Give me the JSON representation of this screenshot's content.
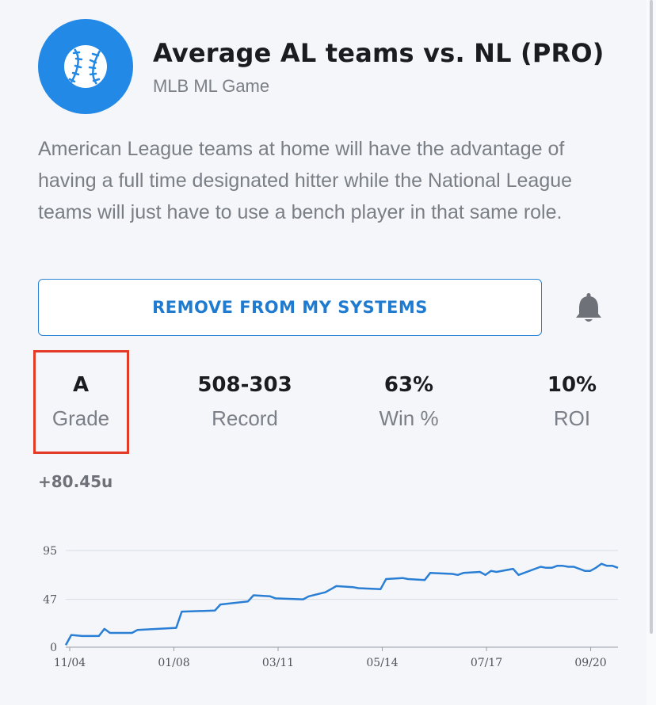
{
  "header": {
    "title": "Average AL teams vs. NL (PRO)",
    "subtitle": "MLB ML Game",
    "logo_icon": "baseball-icon",
    "logo_color": "#2289e6"
  },
  "description": "American League teams at home will have the advantage of having a full time designated hitter while the National League teams will just have to use a bench player in that same role.",
  "actions": {
    "remove_label": "REMOVE FROM MY SYSTEMS",
    "alert_icon": "bell-icon"
  },
  "stats": [
    {
      "value": "A",
      "label": "Grade"
    },
    {
      "value": "508-303",
      "label": "Record"
    },
    {
      "value": "63%",
      "label": "Win %"
    },
    {
      "value": "10%",
      "label": "ROI"
    }
  ],
  "highlight_color": "#e33b25",
  "profit": "+80.45u",
  "chart_data": {
    "type": "line",
    "color": "#2a7fd4",
    "ylim": [
      0,
      95
    ],
    "yticks": [
      0,
      47,
      95
    ],
    "xticks": [
      "11/04",
      "01/08",
      "03/11",
      "05/14",
      "07/17",
      "09/20"
    ],
    "grid": true,
    "x": [
      0,
      1,
      3,
      6,
      7,
      8,
      12,
      13,
      20,
      21,
      27,
      28,
      33,
      34,
      37,
      38,
      43,
      44,
      47,
      48,
      49,
      52,
      53,
      57,
      58,
      61,
      62,
      65,
      66,
      70,
      71,
      72,
      75,
      76,
      77,
      78,
      81,
      82,
      86,
      87,
      88,
      89,
      90,
      91,
      92,
      94,
      95,
      96,
      97,
      98,
      99,
      100
    ],
    "values": [
      2,
      12,
      11,
      11,
      18,
      14,
      14,
      17,
      19,
      35,
      36,
      42,
      45,
      51,
      50,
      48,
      47,
      50,
      54,
      57,
      60,
      59,
      58,
      57,
      67,
      68,
      67,
      66,
      73,
      72,
      71,
      73,
      74,
      71,
      75,
      74,
      77,
      71,
      79,
      78,
      78,
      80,
      80,
      79,
      79,
      75,
      75,
      78,
      82,
      80,
      80,
      78
    ]
  }
}
